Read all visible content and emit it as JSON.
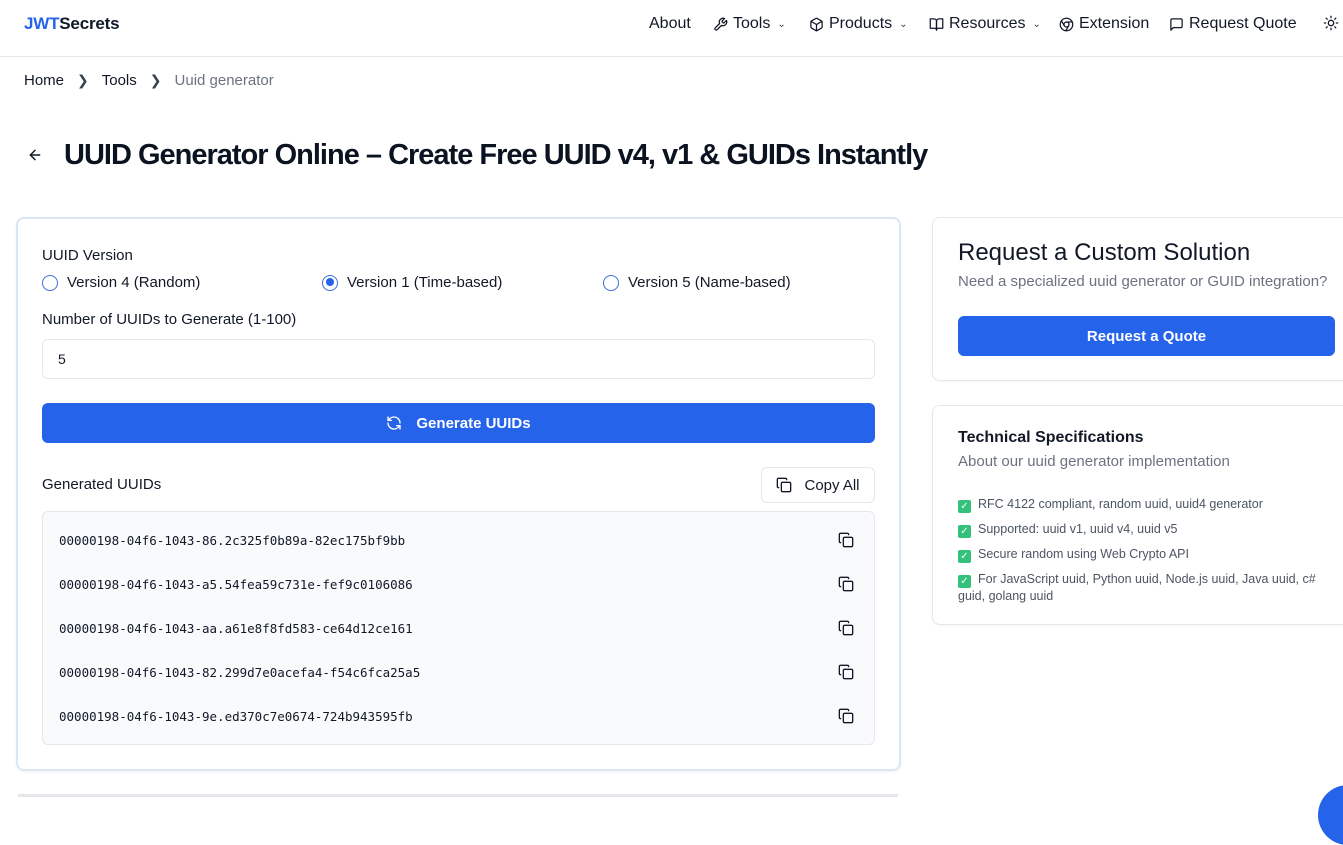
{
  "header": {
    "logo_primary": "JWT",
    "logo_secondary": "Secrets",
    "nav": {
      "about": "About",
      "tools": "Tools",
      "products": "Products",
      "resources": "Resources",
      "extension": "Extension",
      "request_quote": "Request Quote"
    }
  },
  "breadcrumb": {
    "home": "Home",
    "tools": "Tools",
    "current": "Uuid generator"
  },
  "page": {
    "title": "UUID Generator Online – Create Free UUID v4, v1 & GUIDs Instantly"
  },
  "generator": {
    "version_label": "UUID Version",
    "versions": [
      {
        "label": "Version 4 (Random)",
        "checked": false
      },
      {
        "label": "Version 1 (Time-based)",
        "checked": true
      },
      {
        "label": "Version 5 (Name-based)",
        "checked": false
      }
    ],
    "count_label": "Number of UUIDs to Generate (1-100)",
    "count_value": "5",
    "generate_label": "Generate UUIDs",
    "results_label": "Generated UUIDs",
    "copy_all_label": "Copy All",
    "uuids": [
      "00000198-04f6-1043-86.2c325f0b89a-82ec175bf9bb",
      "00000198-04f6-1043-a5.54fea59c731e-fef9c0106086",
      "00000198-04f6-1043-aa.a61e8f8fd583-ce64d12ce161",
      "00000198-04f6-1043-82.299d7e0acefa4-f54c6fca25a5",
      "00000198-04f6-1043-9e.ed370c7e0674-724b943595fb"
    ]
  },
  "quote_card": {
    "title": "Request a Custom Solution",
    "subtitle": "Need a specialized uuid generator or GUID integration?",
    "button": "Request a Quote"
  },
  "spec_card": {
    "title": "Technical Specifications",
    "subtitle": "About our uuid generator implementation",
    "items": [
      "RFC 4122 compliant, random uuid, uuid4 generator",
      "Supported: uuid v1, uuid v4, uuid v5",
      "Secure random using Web Crypto API",
      "For JavaScript uuid, Python uuid, Node.js uuid, Java uuid, c# guid, golang uuid"
    ]
  },
  "colors": {
    "accent": "#2563eb",
    "check": "#34c27a"
  }
}
